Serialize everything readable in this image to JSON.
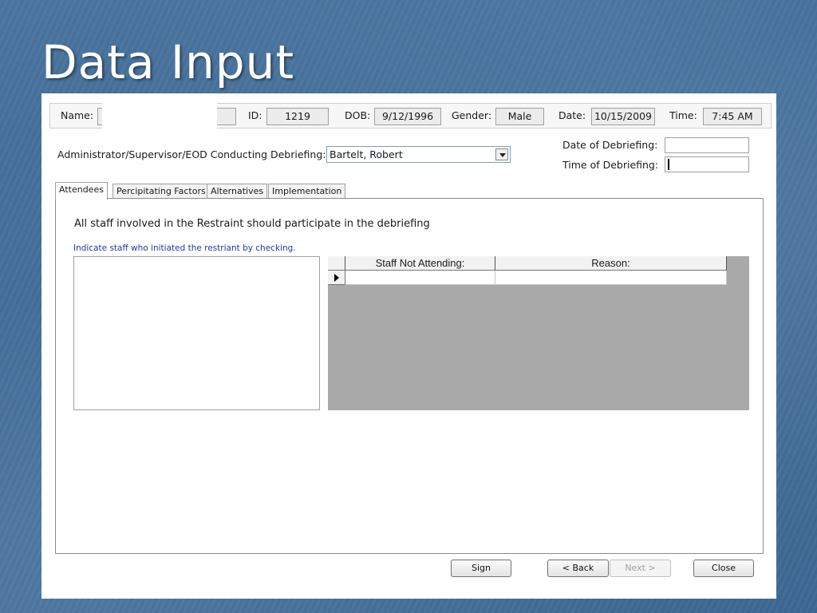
{
  "slide": {
    "title": "Data Input"
  },
  "header": {
    "name_label": "Name:",
    "name_value": "",
    "id_label": "ID:",
    "id_value": "1219",
    "dob_label": "DOB:",
    "dob_value": "9/12/1996",
    "gender_label": "Gender:",
    "gender_value": "Male",
    "date_label": "Date:",
    "date_value": "10/15/2009",
    "time_label": "Time:",
    "time_value": "7:45 AM"
  },
  "debrief": {
    "conductor_label": "Administrator/Supervisor/EOD Conducting Debriefing:",
    "conductor_value": "Bartelt, Robert",
    "date_label": "Date of Debriefing:",
    "date_value": "",
    "time_label": "Time of Debriefing:",
    "time_value": ""
  },
  "tabs": [
    {
      "label": "Attendees",
      "active": true
    },
    {
      "label": "Percipitating Factors",
      "active": false
    },
    {
      "label": "Alternatives",
      "active": false
    },
    {
      "label": "Implementation",
      "active": false
    }
  ],
  "attendees": {
    "instruction": "All staff involved in the Restraint should participate in the debriefing",
    "hint": "Indicate staff who initiated the restriant by checking.",
    "grid_headers": [
      "Staff Not Attending:",
      "Reason:"
    ]
  },
  "buttons": {
    "sign": "Sign",
    "back": "< Back",
    "next": "Next >",
    "close": "Close"
  },
  "colors": {
    "hint_text": "#1f3aa0",
    "grid_background": "#a9a9a9"
  }
}
